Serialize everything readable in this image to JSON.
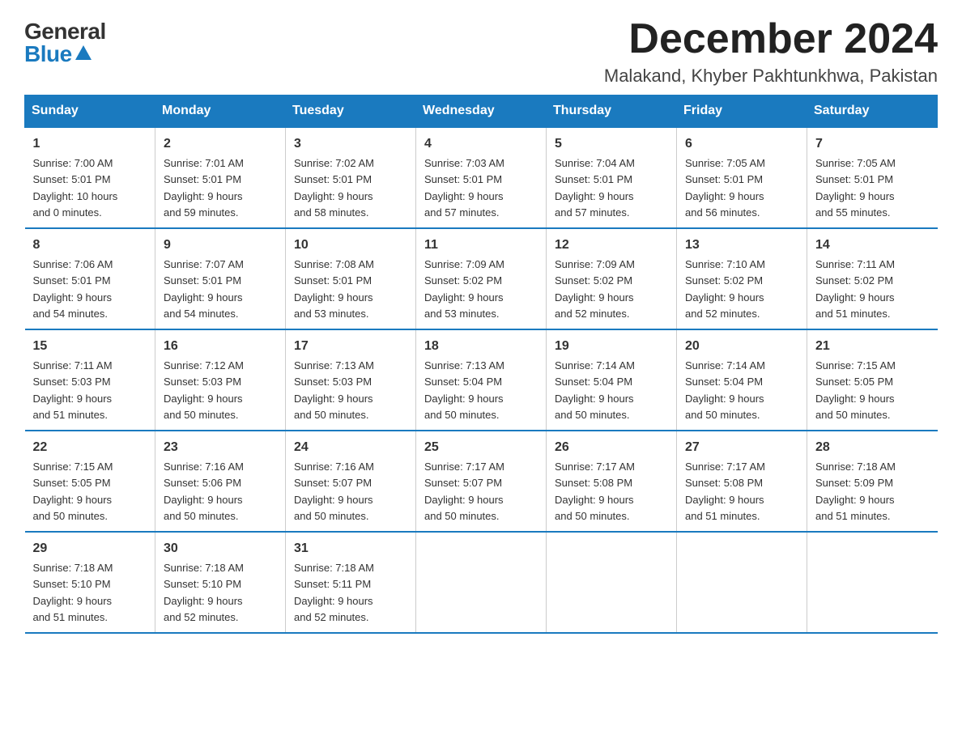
{
  "header": {
    "logo_general": "General",
    "logo_blue": "Blue",
    "month_title": "December 2024",
    "location": "Malakand, Khyber Pakhtunkhwa, Pakistan"
  },
  "days_of_week": [
    "Sunday",
    "Monday",
    "Tuesday",
    "Wednesday",
    "Thursday",
    "Friday",
    "Saturday"
  ],
  "weeks": [
    [
      {
        "num": "1",
        "sunrise": "7:00 AM",
        "sunset": "5:01 PM",
        "daylight": "10 hours and 0 minutes."
      },
      {
        "num": "2",
        "sunrise": "7:01 AM",
        "sunset": "5:01 PM",
        "daylight": "9 hours and 59 minutes."
      },
      {
        "num": "3",
        "sunrise": "7:02 AM",
        "sunset": "5:01 PM",
        "daylight": "9 hours and 58 minutes."
      },
      {
        "num": "4",
        "sunrise": "7:03 AM",
        "sunset": "5:01 PM",
        "daylight": "9 hours and 57 minutes."
      },
      {
        "num": "5",
        "sunrise": "7:04 AM",
        "sunset": "5:01 PM",
        "daylight": "9 hours and 57 minutes."
      },
      {
        "num": "6",
        "sunrise": "7:05 AM",
        "sunset": "5:01 PM",
        "daylight": "9 hours and 56 minutes."
      },
      {
        "num": "7",
        "sunrise": "7:05 AM",
        "sunset": "5:01 PM",
        "daylight": "9 hours and 55 minutes."
      }
    ],
    [
      {
        "num": "8",
        "sunrise": "7:06 AM",
        "sunset": "5:01 PM",
        "daylight": "9 hours and 54 minutes."
      },
      {
        "num": "9",
        "sunrise": "7:07 AM",
        "sunset": "5:01 PM",
        "daylight": "9 hours and 54 minutes."
      },
      {
        "num": "10",
        "sunrise": "7:08 AM",
        "sunset": "5:01 PM",
        "daylight": "9 hours and 53 minutes."
      },
      {
        "num": "11",
        "sunrise": "7:09 AM",
        "sunset": "5:02 PM",
        "daylight": "9 hours and 53 minutes."
      },
      {
        "num": "12",
        "sunrise": "7:09 AM",
        "sunset": "5:02 PM",
        "daylight": "9 hours and 52 minutes."
      },
      {
        "num": "13",
        "sunrise": "7:10 AM",
        "sunset": "5:02 PM",
        "daylight": "9 hours and 52 minutes."
      },
      {
        "num": "14",
        "sunrise": "7:11 AM",
        "sunset": "5:02 PM",
        "daylight": "9 hours and 51 minutes."
      }
    ],
    [
      {
        "num": "15",
        "sunrise": "7:11 AM",
        "sunset": "5:03 PM",
        "daylight": "9 hours and 51 minutes."
      },
      {
        "num": "16",
        "sunrise": "7:12 AM",
        "sunset": "5:03 PM",
        "daylight": "9 hours and 50 minutes."
      },
      {
        "num": "17",
        "sunrise": "7:13 AM",
        "sunset": "5:03 PM",
        "daylight": "9 hours and 50 minutes."
      },
      {
        "num": "18",
        "sunrise": "7:13 AM",
        "sunset": "5:04 PM",
        "daylight": "9 hours and 50 minutes."
      },
      {
        "num": "19",
        "sunrise": "7:14 AM",
        "sunset": "5:04 PM",
        "daylight": "9 hours and 50 minutes."
      },
      {
        "num": "20",
        "sunrise": "7:14 AM",
        "sunset": "5:04 PM",
        "daylight": "9 hours and 50 minutes."
      },
      {
        "num": "21",
        "sunrise": "7:15 AM",
        "sunset": "5:05 PM",
        "daylight": "9 hours and 50 minutes."
      }
    ],
    [
      {
        "num": "22",
        "sunrise": "7:15 AM",
        "sunset": "5:05 PM",
        "daylight": "9 hours and 50 minutes."
      },
      {
        "num": "23",
        "sunrise": "7:16 AM",
        "sunset": "5:06 PM",
        "daylight": "9 hours and 50 minutes."
      },
      {
        "num": "24",
        "sunrise": "7:16 AM",
        "sunset": "5:07 PM",
        "daylight": "9 hours and 50 minutes."
      },
      {
        "num": "25",
        "sunrise": "7:17 AM",
        "sunset": "5:07 PM",
        "daylight": "9 hours and 50 minutes."
      },
      {
        "num": "26",
        "sunrise": "7:17 AM",
        "sunset": "5:08 PM",
        "daylight": "9 hours and 50 minutes."
      },
      {
        "num": "27",
        "sunrise": "7:17 AM",
        "sunset": "5:08 PM",
        "daylight": "9 hours and 51 minutes."
      },
      {
        "num": "28",
        "sunrise": "7:18 AM",
        "sunset": "5:09 PM",
        "daylight": "9 hours and 51 minutes."
      }
    ],
    [
      {
        "num": "29",
        "sunrise": "7:18 AM",
        "sunset": "5:10 PM",
        "daylight": "9 hours and 51 minutes."
      },
      {
        "num": "30",
        "sunrise": "7:18 AM",
        "sunset": "5:10 PM",
        "daylight": "9 hours and 52 minutes."
      },
      {
        "num": "31",
        "sunrise": "7:18 AM",
        "sunset": "5:11 PM",
        "daylight": "9 hours and 52 minutes."
      },
      null,
      null,
      null,
      null
    ]
  ]
}
